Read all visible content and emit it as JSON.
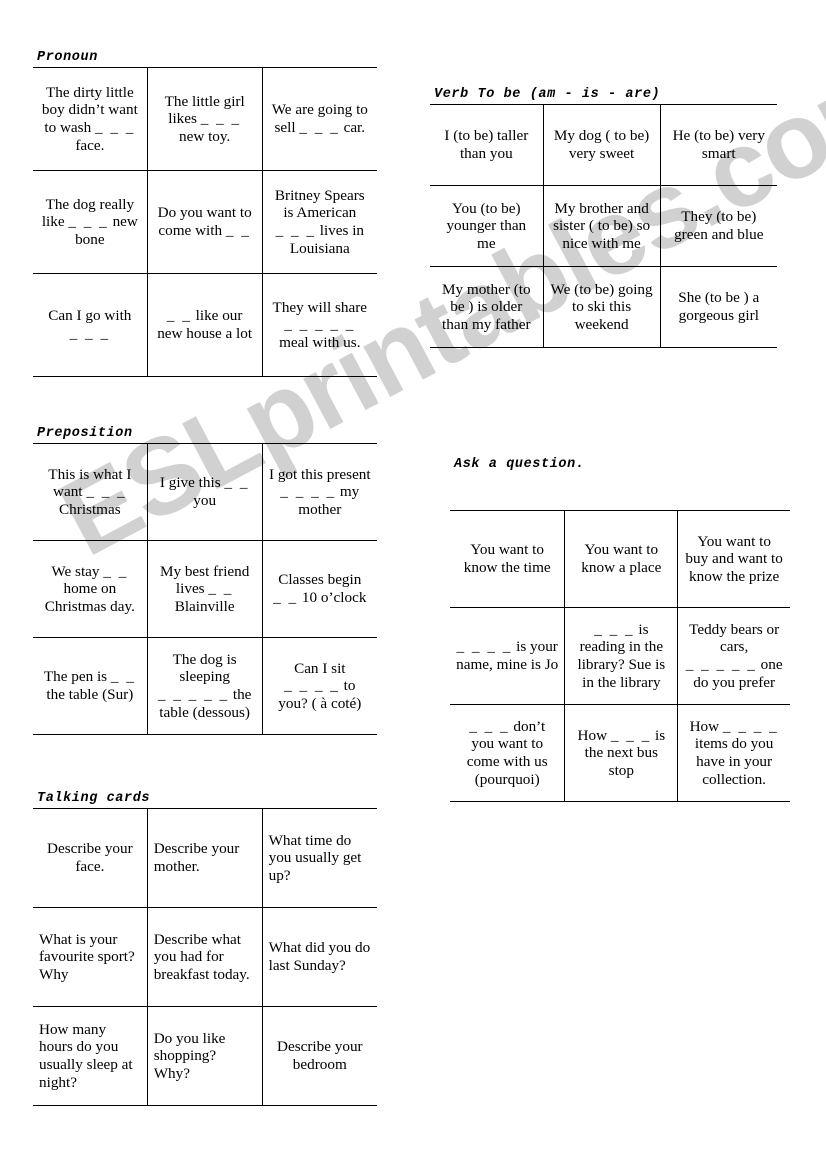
{
  "watermark": {
    "text": "ESLprintables.com",
    "color": "#c9c9c9"
  },
  "sections": [
    {
      "id": "pronoun",
      "title": "Pronoun",
      "rows": [
        [
          "The dirty little boy didn’t want to wash ___ face.",
          "The little girl likes ___ new toy.",
          "We are going to sell ___ car."
        ],
        [
          "The dog really like ___ new bone",
          "Do you want to come with __",
          "Britney Spears is American ___ lives in Louisiana"
        ],
        [
          "Can I go with ___",
          "__ like our new house a lot",
          "They will share _____ meal with us."
        ]
      ]
    },
    {
      "id": "verbtobe",
      "title": "Verb To be (am  - is - are)",
      "rows": [
        [
          "I (to be) taller than you",
          "My dog ( to be) very sweet",
          "He (to be) very smart"
        ],
        [
          "You (to be) younger than me",
          "My brother and sister ( to be) so nice with me",
          "They (to be) green and blue"
        ],
        [
          "My mother (to be ) is older than my father",
          "We (to be) going to ski this weekend",
          "She (to be ) a gorgeous girl"
        ]
      ]
    },
    {
      "id": "preposition",
      "title": "Preposition",
      "rows": [
        [
          "This is what I want ___ Christmas",
          "I give this __ you",
          "I got this present ____ my mother"
        ],
        [
          "We stay __ home on Christmas day.",
          "My best friend lives __ Blainville",
          "Classes begin __ 10 o’clock"
        ],
        [
          "The pen is __ the table (Sur)",
          "The dog is sleeping _____ the table (dessous)",
          "Can I sit ____ to you? ( à coté)"
        ]
      ]
    },
    {
      "id": "askquestion",
      "title": "Ask a question.",
      "rows": [
        [
          "You want to know the time",
          "You want to know a place",
          "You want to buy and want to know the prize"
        ],
        [
          "____ is your name, mine is Jo",
          "___ is reading in the library? Sue is in the library",
          "Teddy bears or cars, _____ one do you prefer"
        ],
        [
          "___ don’t you want to come with us (pourquoi)",
          "How ___ is the next bus stop",
          "How ____ items do you have in your collection."
        ]
      ]
    },
    {
      "id": "talking",
      "title": "Talking cards",
      "align": [
        "center",
        "left",
        "left"
      ],
      "rows": [
        [
          "Describe your face.",
          "Describe your mother.",
          "What time do you usually get up?"
        ],
        [
          "What is your favourite sport? Why",
          "Describe what you had for breakfast today.",
          "What did you do last Sunday?"
        ],
        [
          "How many hours do you usually sleep at night?",
          "Do you like shopping? Why?",
          "Describe your bedroom"
        ]
      ]
    }
  ]
}
